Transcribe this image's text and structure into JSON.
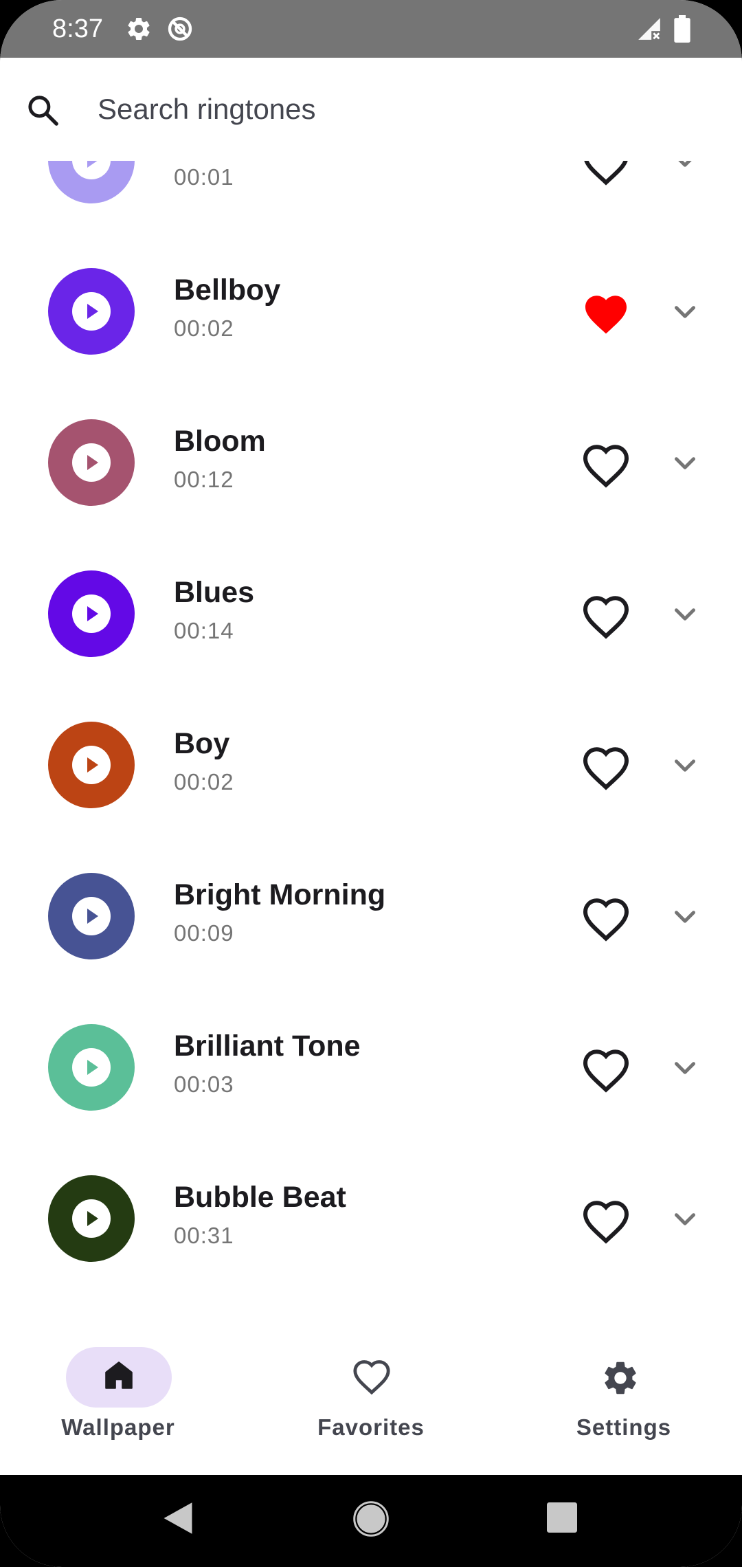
{
  "status_bar": {
    "time": "8:37"
  },
  "search": {
    "placeholder": "Search ringtones"
  },
  "ringtones": [
    {
      "title": "",
      "duration": "00:01",
      "color": "#a99bf2",
      "favorite": false
    },
    {
      "title": "Bellboy",
      "duration": "00:02",
      "color": "#6a25e8",
      "favorite": true
    },
    {
      "title": "Bloom",
      "duration": "00:12",
      "color": "#a5536f",
      "favorite": false
    },
    {
      "title": "Blues",
      "duration": "00:14",
      "color": "#6309e6",
      "favorite": false
    },
    {
      "title": "Boy",
      "duration": "00:02",
      "color": "#bc4414",
      "favorite": false
    },
    {
      "title": "Bright Morning",
      "duration": "00:09",
      "color": "#475394",
      "favorite": false
    },
    {
      "title": "Brilliant Tone",
      "duration": "00:03",
      "color": "#5bbf98",
      "favorite": false
    },
    {
      "title": "Bubble Beat",
      "duration": "00:31",
      "color": "#243b12",
      "favorite": false
    }
  ],
  "colors": {
    "favorite_active": "#ff0000",
    "nav_active_pill": "#e8def8"
  },
  "bottom_nav": {
    "items": [
      {
        "label": "Wallpaper",
        "icon": "home-icon",
        "active": true
      },
      {
        "label": "Favorites",
        "icon": "heart-outline-icon",
        "active": false
      },
      {
        "label": "Settings",
        "icon": "gear-icon",
        "active": false
      }
    ]
  }
}
